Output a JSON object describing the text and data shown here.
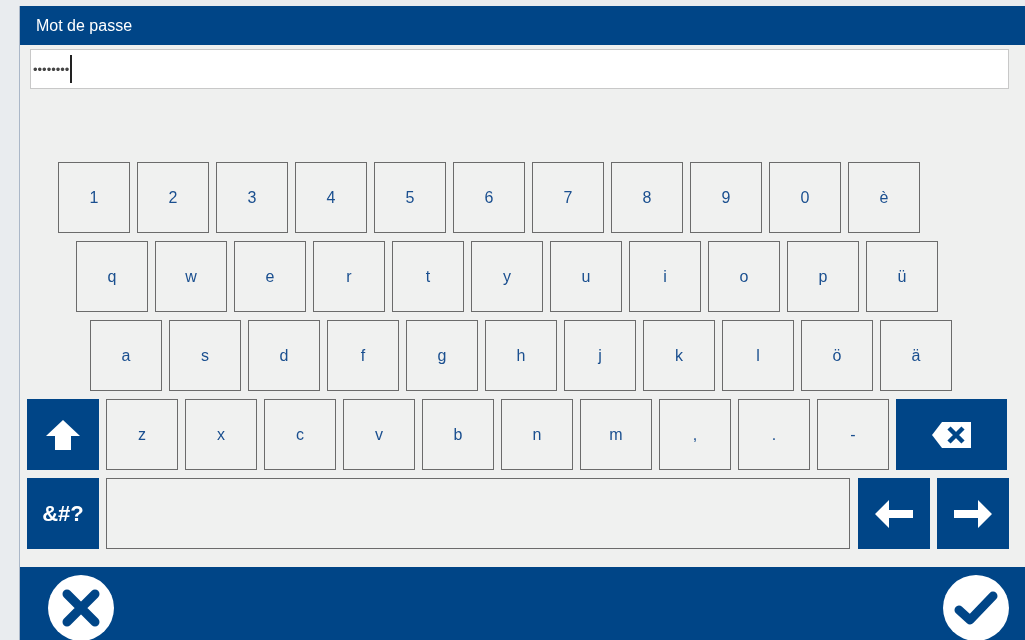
{
  "dialog": {
    "title": "Mot de passe"
  },
  "password_field": {
    "value": "••••••••"
  },
  "keyboard_rows": [
    [
      {
        "kind": "char",
        "label": "1"
      },
      {
        "kind": "char",
        "label": "2"
      },
      {
        "kind": "char",
        "label": "3"
      },
      {
        "kind": "char",
        "label": "4"
      },
      {
        "kind": "char",
        "label": "5"
      },
      {
        "kind": "char",
        "label": "6"
      },
      {
        "kind": "char",
        "label": "7"
      },
      {
        "kind": "char",
        "label": "8"
      },
      {
        "kind": "char",
        "label": "9"
      },
      {
        "kind": "char",
        "label": "0"
      },
      {
        "kind": "char",
        "label": "è"
      }
    ],
    [
      {
        "kind": "char",
        "label": "q"
      },
      {
        "kind": "char",
        "label": "w"
      },
      {
        "kind": "char",
        "label": "e"
      },
      {
        "kind": "char",
        "label": "r"
      },
      {
        "kind": "char",
        "label": "t"
      },
      {
        "kind": "char",
        "label": "y"
      },
      {
        "kind": "char",
        "label": "u"
      },
      {
        "kind": "char",
        "label": "i"
      },
      {
        "kind": "char",
        "label": "o"
      },
      {
        "kind": "char",
        "label": "p"
      },
      {
        "kind": "char",
        "label": "ü"
      }
    ],
    [
      {
        "kind": "char",
        "label": "a"
      },
      {
        "kind": "char",
        "label": "s"
      },
      {
        "kind": "char",
        "label": "d"
      },
      {
        "kind": "char",
        "label": "f"
      },
      {
        "kind": "char",
        "label": "g"
      },
      {
        "kind": "char",
        "label": "h"
      },
      {
        "kind": "char",
        "label": "j"
      },
      {
        "kind": "char",
        "label": "k"
      },
      {
        "kind": "char",
        "label": "l"
      },
      {
        "kind": "char",
        "label": "ö"
      },
      {
        "kind": "char",
        "label": "ä"
      }
    ],
    [
      {
        "kind": "shift"
      },
      {
        "kind": "char",
        "label": "z"
      },
      {
        "kind": "char",
        "label": "x"
      },
      {
        "kind": "char",
        "label": "c"
      },
      {
        "kind": "char",
        "label": "v"
      },
      {
        "kind": "char",
        "label": "b"
      },
      {
        "kind": "char",
        "label": "n"
      },
      {
        "kind": "char",
        "label": "m"
      },
      {
        "kind": "char",
        "label": ","
      },
      {
        "kind": "char",
        "label": "."
      },
      {
        "kind": "char",
        "label": "-"
      },
      {
        "kind": "backspace"
      }
    ],
    [
      {
        "kind": "symbols",
        "label": "&#?"
      },
      {
        "kind": "space"
      },
      {
        "kind": "left"
      },
      {
        "kind": "right"
      }
    ]
  ],
  "footer": {
    "buttons": [
      {
        "kind": "cancel"
      },
      {
        "kind": "confirm"
      }
    ]
  }
}
